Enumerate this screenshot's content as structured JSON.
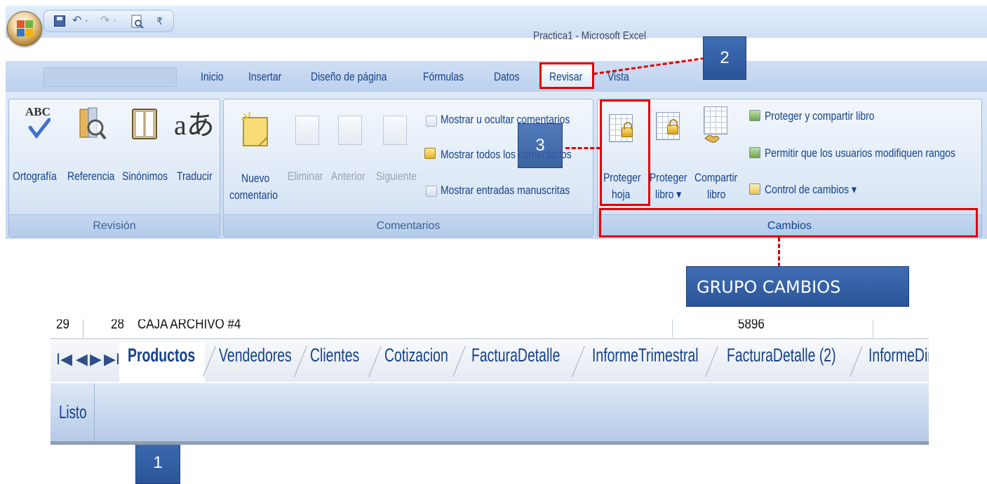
{
  "window": {
    "title": "Practica1 - Microsoft Excel",
    "qat_undo": "↶ ·",
    "qat_redo": "↷ ·",
    "qat_more": "₹"
  },
  "tabs": [
    {
      "label": "Inicio"
    },
    {
      "label": "Insertar"
    },
    {
      "label": "Diseño de página"
    },
    {
      "label": "Fórmulas"
    },
    {
      "label": "Datos"
    },
    {
      "label": "Revisar"
    },
    {
      "label": "Vista"
    }
  ],
  "ribbon": {
    "revision": {
      "group_label": "Revisión",
      "buttons": {
        "spelling": "Ortografía",
        "reference": "Referencia",
        "synonyms": "Sinónimos",
        "translate": "Traducir"
      },
      "abc_text": "ABC",
      "translate_glyph": "aあ"
    },
    "comentarios": {
      "group_label": "Comentarios",
      "new_comment_line1": "Nuevo",
      "new_comment_line2": "comentario",
      "delete": "Eliminar",
      "previous": "Anterior",
      "next": "Siguiente",
      "show_hide": "Mostrar u ocultar comentarios",
      "show_all": "Mostrar todos los comentarios",
      "show_ink": "Mostrar entradas manuscritas"
    },
    "cambios": {
      "group_label": "Cambios",
      "protect_sheet_line1": "Proteger",
      "protect_sheet_line2": "hoja",
      "protect_book_line1": "Proteger",
      "protect_book_line2": "libro ▾",
      "share_book_line1": "Compartir",
      "share_book_line2": "libro",
      "protect_share": "Proteger y compartir libro",
      "allow_edit_ranges": "Permitir que los usuarios modifiquen rangos",
      "track_changes": "Control de cambios ▾"
    }
  },
  "annotations": {
    "label1": "1",
    "label2": "2",
    "label3": "3",
    "group_callout": "GRUPO CAMBIOS"
  },
  "sheet": {
    "row_number": "29",
    "row_index": "28",
    "row_text": "CAJA ARCHIVO #4",
    "row_value": "5896",
    "nav": [
      "I◀",
      "◀",
      "▶",
      "▶I"
    ],
    "tabs": [
      "Productos",
      "Vendedores",
      "Clientes",
      "Cotizacion",
      "FacturaDetalle",
      "InformeTrimestral",
      "FacturaDetalle (2)",
      "InformeDir"
    ],
    "status": "Listo"
  },
  "colors": {
    "annotation_red": "#e00000",
    "callout_blue": "#2b5599",
    "ribbon_text": "#15428b"
  }
}
